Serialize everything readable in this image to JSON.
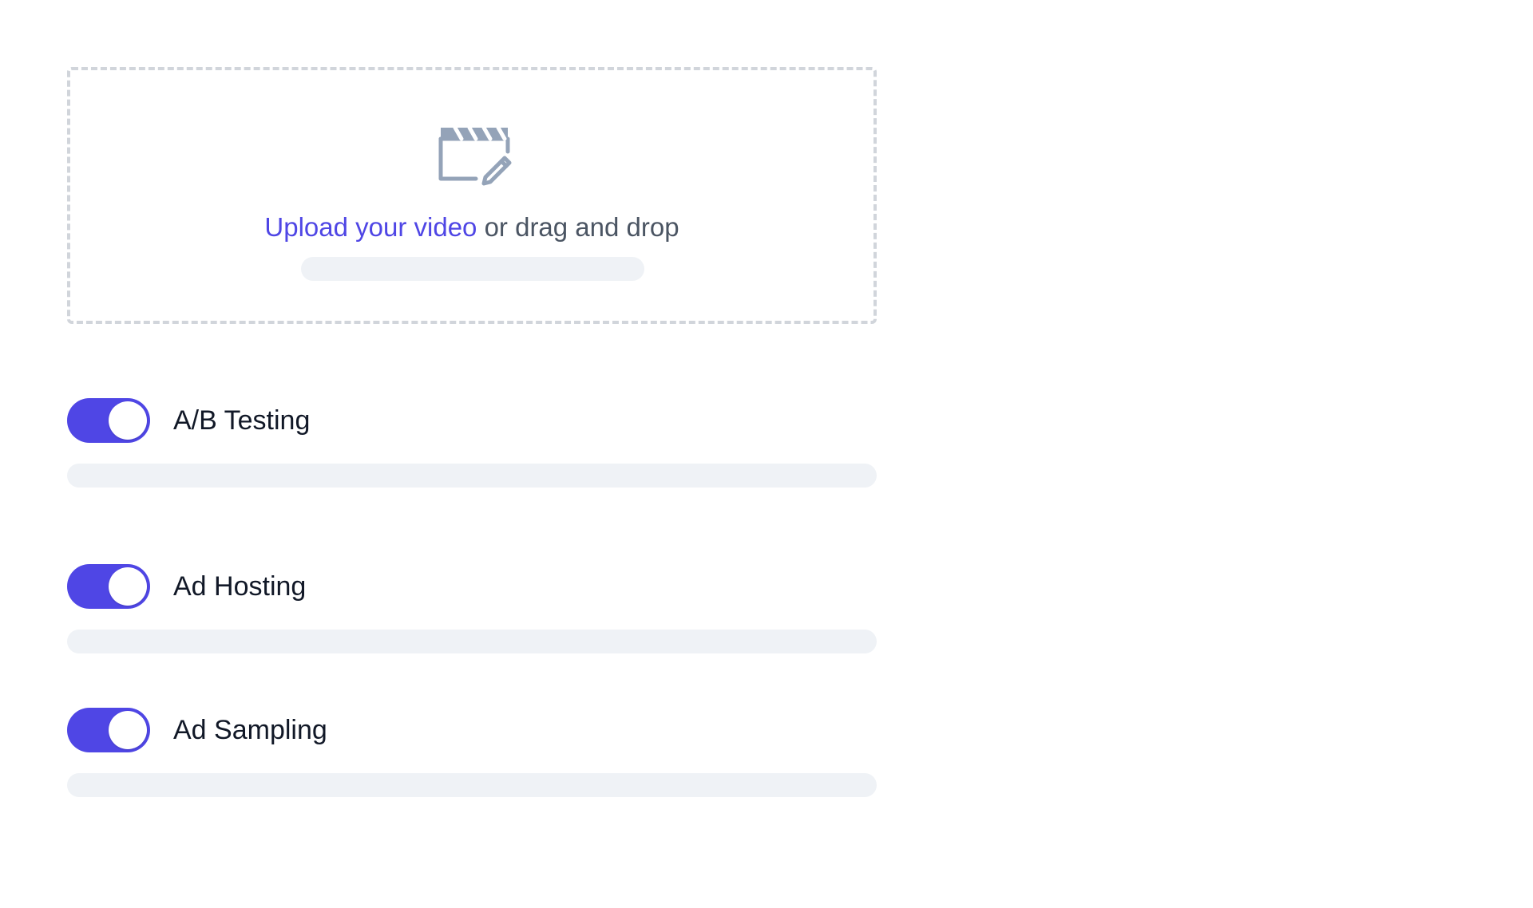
{
  "upload": {
    "icon": "video-edit-icon",
    "link_text": "Upload your video",
    "rest_text": " or drag and drop"
  },
  "toggles": [
    {
      "label": "A/B Testing",
      "enabled": true
    },
    {
      "label": "Ad Hosting",
      "enabled": true
    },
    {
      "label": "Ad Sampling",
      "enabled": true
    }
  ],
  "colors": {
    "accent": "#4f46e5",
    "text_primary": "#111827",
    "text_secondary": "#4b5563",
    "icon": "#94a3b8",
    "placeholder": "#eff2f6",
    "dashed_border": "#d1d5db"
  }
}
